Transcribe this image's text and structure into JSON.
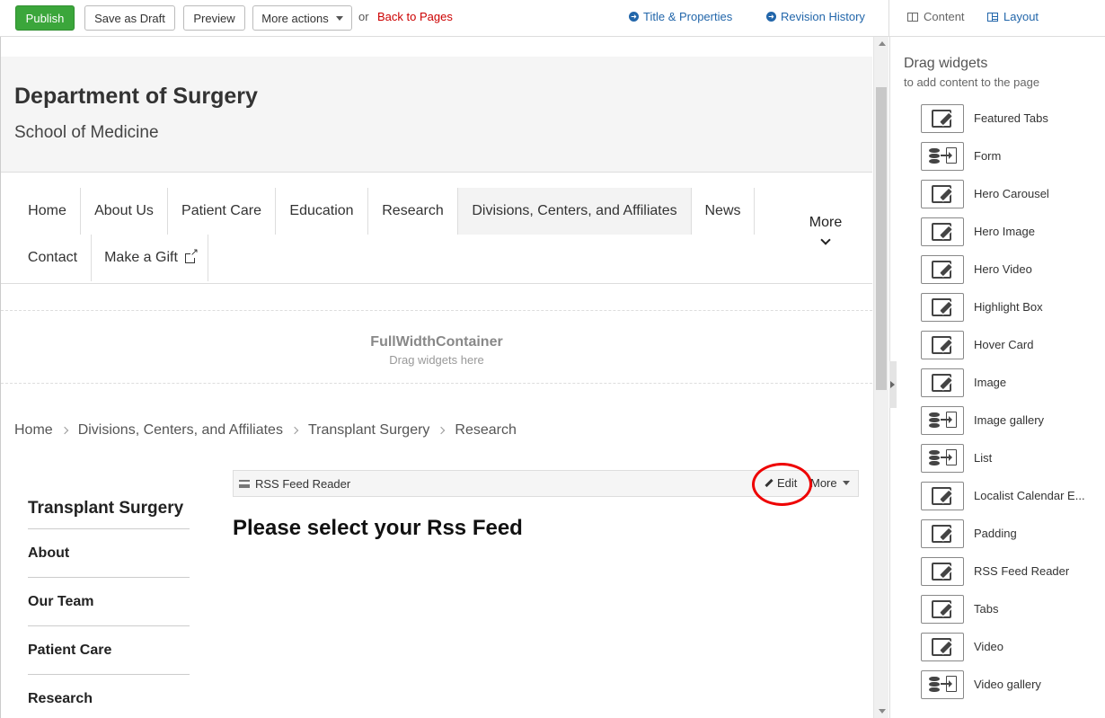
{
  "toolbar": {
    "publish": "Publish",
    "save_draft": "Save as Draft",
    "preview": "Preview",
    "more_actions": "More actions",
    "or": "or",
    "back_to_pages": "Back to Pages",
    "title_properties": "Title & Properties",
    "revision_history": "Revision History",
    "content_mode": "Content",
    "layout_mode": "Layout"
  },
  "colors": {
    "publish_green": "#3ba63b",
    "link_blue": "#2266aa",
    "back_red": "#cc0000",
    "highlight_circle": "#ee0000"
  },
  "page": {
    "site_title": "Department of Surgery",
    "site_subtitle": "School of Medicine",
    "nav": [
      {
        "label": "Home"
      },
      {
        "label": "About Us"
      },
      {
        "label": "Patient Care"
      },
      {
        "label": "Education"
      },
      {
        "label": "Research"
      },
      {
        "label": "Divisions, Centers, and Affiliates"
      },
      {
        "label": "News"
      },
      {
        "label": "Contact"
      },
      {
        "label": "Make a Gift"
      }
    ],
    "nav_more": "More",
    "container": {
      "title": "FullWidthContainer",
      "hint": "Drag widgets here"
    },
    "breadcrumb": [
      "Home",
      "Divisions, Centers, and Affiliates",
      "Transplant Surgery",
      "Research"
    ],
    "side_nav": {
      "title": "Transplant Surgery",
      "items": [
        "About",
        "Our Team",
        "Patient Care",
        "Research"
      ]
    },
    "widget": {
      "name": "RSS Feed Reader",
      "edit": "Edit",
      "more": "More",
      "placeholder_heading": "Please select your Rss Feed"
    }
  },
  "panel": {
    "title": "Drag widgets",
    "subtitle": "to add content to the page",
    "widgets": [
      {
        "label": "Featured Tabs",
        "icon": "edit-icon"
      },
      {
        "label": "Form",
        "icon": "database-import-icon"
      },
      {
        "label": "Hero Carousel",
        "icon": "edit-icon"
      },
      {
        "label": "Hero Image",
        "icon": "edit-icon"
      },
      {
        "label": "Hero Video",
        "icon": "edit-icon"
      },
      {
        "label": "Highlight Box",
        "icon": "edit-icon"
      },
      {
        "label": "Hover Card",
        "icon": "edit-icon"
      },
      {
        "label": "Image",
        "icon": "edit-icon"
      },
      {
        "label": "Image gallery",
        "icon": "database-import-icon"
      },
      {
        "label": "List",
        "icon": "database-import-icon"
      },
      {
        "label": "Localist Calendar E...",
        "icon": "edit-icon"
      },
      {
        "label": "Padding",
        "icon": "edit-icon"
      },
      {
        "label": "RSS Feed Reader",
        "icon": "edit-icon"
      },
      {
        "label": "Tabs",
        "icon": "edit-icon"
      },
      {
        "label": "Video",
        "icon": "edit-icon"
      },
      {
        "label": "Video gallery",
        "icon": "database-import-icon"
      }
    ]
  }
}
